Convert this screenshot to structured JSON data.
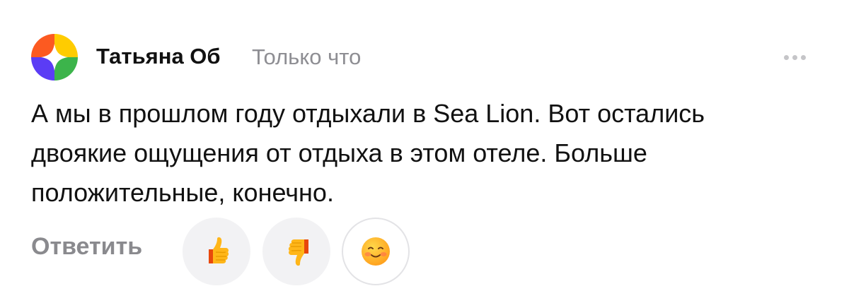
{
  "comment": {
    "author": "Татьяна Об",
    "timestamp": "Только что",
    "menu_icon": "more-dots-icon",
    "text_lines": [
      "А мы в прошлом году отдыхали в Sea Lion. Вот остались",
      "двоякие ощущения от отдыха в этом отеле. Больше",
      "положительные, конечно."
    ]
  },
  "actions": {
    "reply_label": "Ответить",
    "reactions": [
      {
        "icon": "thumbs-up-icon"
      },
      {
        "icon": "thumbs-down-icon"
      },
      {
        "icon": "smiley-face-icon"
      }
    ]
  },
  "colors": {
    "author_text": "#111111",
    "timestamp_text": "#8e8e93",
    "reply_text": "#8a8a8e",
    "reaction_bg": "#f2f2f4",
    "avatar_orange": "#fc5a21",
    "avatar_yellow": "#ffcc00",
    "avatar_green": "#3cb44b",
    "avatar_purple": "#5b3cf5"
  }
}
